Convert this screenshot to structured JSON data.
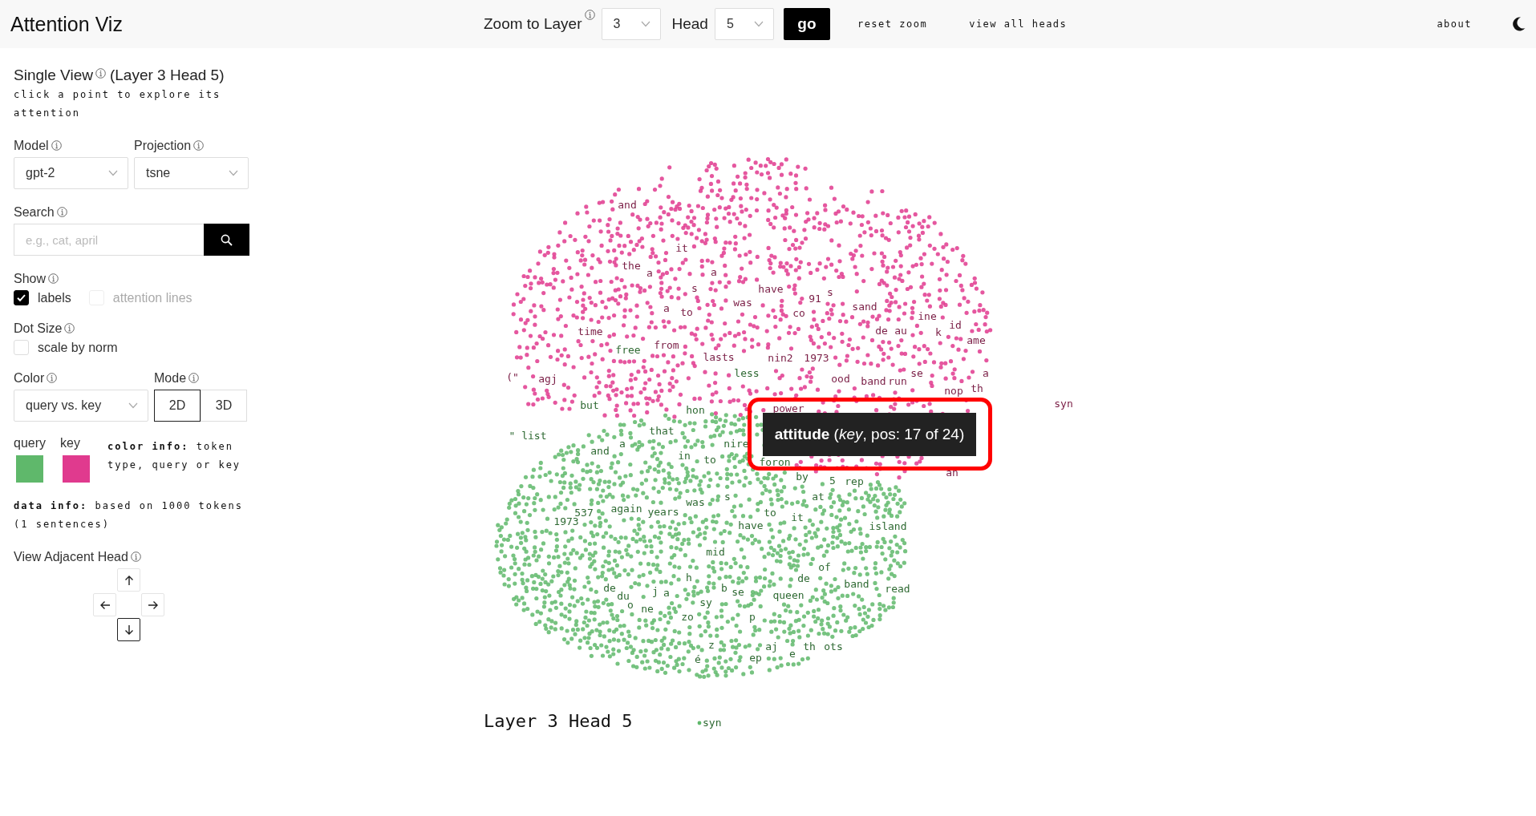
{
  "app": {
    "title": "Attention Viz"
  },
  "header": {
    "zoom_label": "Zoom to Layer",
    "layer": "3",
    "head_label": "Head",
    "head": "5",
    "go": "go",
    "links": [
      "reset zoom",
      "view all heads"
    ],
    "about": "about"
  },
  "sidebar": {
    "title": "Single View",
    "subtitle": "(Layer 3 Head 5)",
    "hint": "click a point to explore its attention",
    "model": {
      "label": "Model",
      "value": "gpt-2"
    },
    "projection": {
      "label": "Projection",
      "value": "tsne"
    },
    "search": {
      "label": "Search",
      "placeholder": "e.g., cat, april"
    },
    "show": {
      "label": "Show",
      "options": [
        {
          "label": "labels",
          "checked": true,
          "disabled": false
        },
        {
          "label": "attention lines",
          "checked": false,
          "disabled": true
        }
      ]
    },
    "dot_size": {
      "label": "Dot Size",
      "options": [
        {
          "label": "scale by norm",
          "checked": false,
          "disabled": false
        }
      ]
    },
    "color": {
      "label": "Color",
      "value": "query vs. key"
    },
    "mode": {
      "label": "Mode",
      "buttons": [
        {
          "label": "2D",
          "selected": true
        },
        {
          "label": "3D",
          "selected": false
        }
      ]
    },
    "legend": [
      {
        "label": "query",
        "color": "#5fb86b"
      },
      {
        "label": "key",
        "color": "#e03a8e"
      }
    ],
    "color_info": "**color info:** token type, query or key",
    "data_info": "**data info:** based on 1000 tokens (1 sentences)",
    "adjacent": {
      "label": "View Adjacent Head",
      "arrows": [
        {
          "kind": "up",
          "selected": false
        },
        {
          "kind": "left",
          "selected": false
        },
        {
          "kind": "right",
          "selected": false
        },
        {
          "kind": "down",
          "selected": true
        }
      ]
    }
  },
  "plot": {
    "caption": "Layer 3 Head 5",
    "highlight": true,
    "tooltip": {
      "text": "**attitude** (*key*, pos: 17 of 24)"
    },
    "labels": [
      {
        "text": "and",
        "kind": "key"
      },
      {
        "text": "it",
        "kind": "key"
      },
      {
        "text": "the",
        "kind": "key"
      },
      {
        "text": "a",
        "kind": "key"
      },
      {
        "text": "a",
        "kind": "key"
      },
      {
        "text": "s",
        "kind": "key"
      },
      {
        "text": "have",
        "kind": "key"
      },
      {
        "text": "91",
        "kind": "key"
      },
      {
        "text": "s",
        "kind": "key"
      },
      {
        "text": "a",
        "kind": "key"
      },
      {
        "text": "to",
        "kind": "key"
      },
      {
        "text": "was",
        "kind": "key"
      },
      {
        "text": "co",
        "kind": "key"
      },
      {
        "text": "sand",
        "kind": "key"
      },
      {
        "text": "ine",
        "kind": "key"
      },
      {
        "text": "id",
        "kind": "key"
      },
      {
        "text": "time",
        "kind": "key"
      },
      {
        "text": "de",
        "kind": "key"
      },
      {
        "text": "au",
        "kind": "key"
      },
      {
        "text": "k",
        "kind": "key"
      },
      {
        "text": "ame",
        "kind": "key"
      },
      {
        "text": "free",
        "kind": "query"
      },
      {
        "text": "from",
        "kind": "key"
      },
      {
        "text": "lasts",
        "kind": "key"
      },
      {
        "text": "nin2",
        "kind": "key"
      },
      {
        "text": "1973",
        "kind": "key"
      },
      {
        "text": "less",
        "kind": "query"
      },
      {
        "text": "ood",
        "kind": "key"
      },
      {
        "text": "band",
        "kind": "key"
      },
      {
        "text": "run",
        "kind": "key"
      },
      {
        "text": "se",
        "kind": "key"
      },
      {
        "text": "a",
        "kind": "key"
      },
      {
        "text": "nop",
        "kind": "key"
      },
      {
        "text": "th",
        "kind": "key"
      },
      {
        "text": "(\"",
        "kind": "key"
      },
      {
        "text": "agj",
        "kind": "key"
      },
      {
        "text": "but",
        "kind": "query"
      },
      {
        "text": "hon",
        "kind": "query"
      },
      {
        "text": "power",
        "kind": "key"
      },
      {
        "text": "syn",
        "kind": "key"
      },
      {
        "text": "\" list",
        "kind": "query"
      },
      {
        "text": "that",
        "kind": "query"
      },
      {
        "text": "and",
        "kind": "query"
      },
      {
        "text": "a",
        "kind": "query"
      },
      {
        "text": "nire",
        "kind": "query"
      },
      {
        "text": "in",
        "kind": "query"
      },
      {
        "text": "to",
        "kind": "query"
      },
      {
        "text": "foron",
        "kind": "query"
      },
      {
        "text": "by",
        "kind": "query"
      },
      {
        "text": "5",
        "kind": "query"
      },
      {
        "text": "rep",
        "kind": "query"
      },
      {
        "text": "an",
        "kind": "key"
      },
      {
        "text": "was",
        "kind": "query"
      },
      {
        "text": "s",
        "kind": "query"
      },
      {
        "text": "at",
        "kind": "query"
      },
      {
        "text": "1973",
        "kind": "query"
      },
      {
        "text": "537",
        "kind": "query"
      },
      {
        "text": "again",
        "kind": "query"
      },
      {
        "text": "years",
        "kind": "query"
      },
      {
        "text": "to",
        "kind": "query"
      },
      {
        "text": "it",
        "kind": "query"
      },
      {
        "text": "have",
        "kind": "query"
      },
      {
        "text": "island",
        "kind": "query"
      },
      {
        "text": "mid",
        "kind": "query"
      },
      {
        "text": "of",
        "kind": "query"
      },
      {
        "text": "h",
        "kind": "query"
      },
      {
        "text": "de",
        "kind": "query"
      },
      {
        "text": "band",
        "kind": "query"
      },
      {
        "text": "de",
        "kind": "query"
      },
      {
        "text": "du",
        "kind": "query"
      },
      {
        "text": "j",
        "kind": "query"
      },
      {
        "text": "a",
        "kind": "query"
      },
      {
        "text": "b",
        "kind": "query"
      },
      {
        "text": "se",
        "kind": "query"
      },
      {
        "text": "queen",
        "kind": "query"
      },
      {
        "text": "read",
        "kind": "query"
      },
      {
        "text": "o",
        "kind": "query"
      },
      {
        "text": "ne",
        "kind": "query"
      },
      {
        "text": "sy",
        "kind": "query"
      },
      {
        "text": "zo",
        "kind": "query"
      },
      {
        "text": "p",
        "kind": "query"
      },
      {
        "text": "z",
        "kind": "query"
      },
      {
        "text": "aj",
        "kind": "query"
      },
      {
        "text": "th",
        "kind": "query"
      },
      {
        "text": "ots",
        "kind": "query"
      },
      {
        "text": "e",
        "kind": "query"
      },
      {
        "text": "é",
        "kind": "query"
      },
      {
        "text": "ep",
        "kind": "query"
      },
      {
        "text": "syn",
        "kind": "query"
      }
    ]
  }
}
